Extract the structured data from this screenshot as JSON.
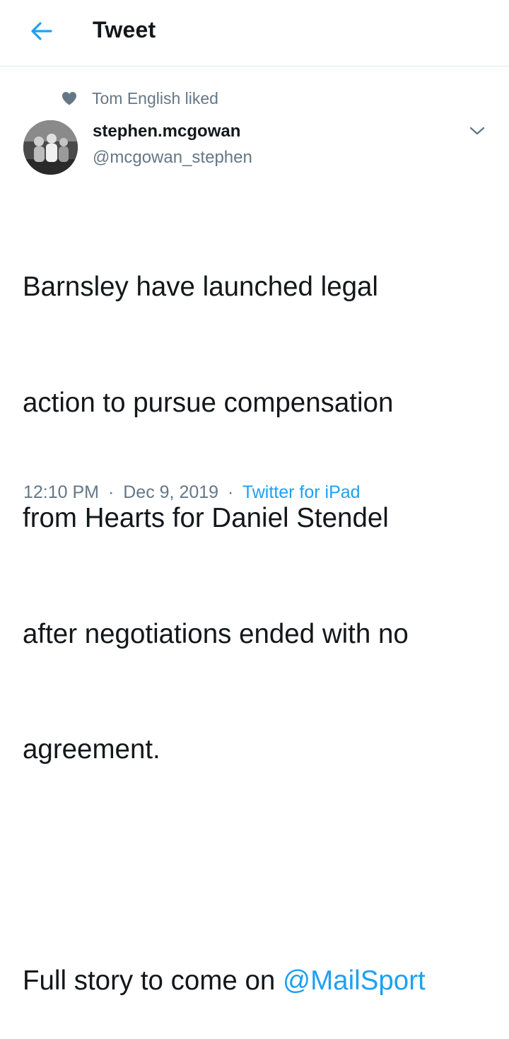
{
  "header": {
    "title": "Tweet",
    "back_icon": "arrow-left-icon"
  },
  "social_context": {
    "icon": "heart-icon",
    "text": "Tom English liked"
  },
  "author": {
    "display_name": "stephen.mcgowan",
    "handle": "@mcgowan_stephen"
  },
  "tweet": {
    "line1": "Barnsley have launched legal",
    "line2": "action to pursue compensation",
    "line3": "from Hearts for Daniel Stendel",
    "line4": "after negotiations ended with no",
    "line5": "agreement.",
    "line6_prefix": "Full story to come on ",
    "mention": "@MailSport"
  },
  "meta": {
    "time": "12:10 PM",
    "separator1": "·",
    "date": "Dec 9, 2019",
    "separator2": "·",
    "source": "Twitter for iPad"
  },
  "colors": {
    "accent": "#1da1f2",
    "secondary_text": "#657786",
    "primary_text": "#14171a",
    "divider": "#e1e8ed"
  }
}
